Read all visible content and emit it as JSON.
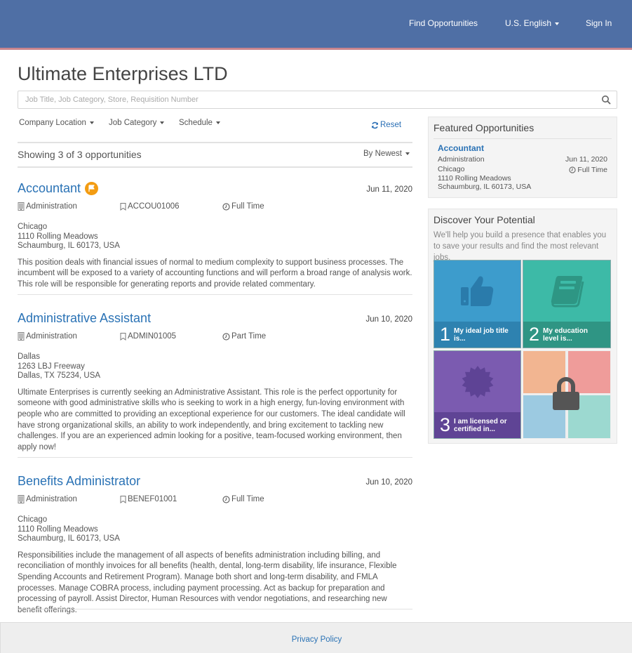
{
  "header": {
    "nav": [
      {
        "label": "Find Opportunities"
      },
      {
        "label": "U.S. English"
      },
      {
        "label": "Sign In"
      }
    ]
  },
  "page": {
    "title": "Ultimate Enterprises LTD",
    "search_placeholder": "Job Title, Job Category, Store, Requisition Number",
    "search_value": ""
  },
  "filters": {
    "items": [
      {
        "label": "Company Location"
      },
      {
        "label": "Job Category"
      },
      {
        "label": "Schedule"
      }
    ],
    "reset_label": "Reset"
  },
  "results": {
    "summary": "Showing 3 of 3 opportunities",
    "sort_label": "By Newest"
  },
  "jobs": [
    {
      "title": "Accountant",
      "featured": true,
      "date": "Jun 11, 2020",
      "category": "Administration",
      "requisition": "ACCOU01006",
      "schedule": "Full Time",
      "address": [
        "Chicago",
        "1110 Rolling Meadows",
        "Schaumburg, IL 60173, USA"
      ],
      "description": "This position deals with financial issues of normal to medium complexity to support business processes. The incumbent will be exposed to a variety of accounting functions and will perform a broad range of analysis work. This role will be responsible for generating reports and provide related commentary."
    },
    {
      "title": "Administrative Assistant",
      "featured": false,
      "date": "Jun 10, 2020",
      "category": "Administration",
      "requisition": "ADMIN01005",
      "schedule": "Part Time",
      "address": [
        "Dallas",
        "1263 LBJ Freeway",
        "Dallas, TX 75234, USA"
      ],
      "description": "Ultimate Enterprises is currently seeking an Administrative Assistant. This role is the perfect opportunity for someone with good administrative skills who is seeking to work in a high energy, fun-loving environment with people who are committed to providing an exceptional experience for our customers. The ideal candidate will have strong organizational skills, an ability to work independently, and bring excitement to tackling new challenges. If you are an experienced admin looking for a positive, team-focused working environment, then apply now!"
    },
    {
      "title": "Benefits Administrator",
      "featured": false,
      "date": "Jun 10, 2020",
      "category": "Administration",
      "requisition": "BENEF01001",
      "schedule": "Full Time",
      "address": [
        "Chicago",
        "1110 Rolling Meadows",
        "Schaumburg, IL 60173, USA"
      ],
      "description": "Responsibilities include the management of all aspects of benefits administration including billing, and reconciliation of monthly invoices for all benefits (health, dental, long-term disability, life insurance, Flexible Spending Accounts and Retirement Program). Manage both short and long-term disability, and FMLA processes. Manage COBRA process, including payment processing. Act as backup for preparation and processing of payroll. Assist Director, Human Resources with vendor negotiations, and researching new benefit offerings."
    }
  ],
  "featured": {
    "title": "Featured Opportunities",
    "item": {
      "title": "Accountant",
      "category": "Administration",
      "date": "Jun 11, 2020",
      "schedule": "Full Time",
      "address": [
        "Chicago",
        "1110 Rolling Meadows",
        "Schaumburg, IL 60173, USA"
      ]
    }
  },
  "discover": {
    "title": "Discover Your Potential",
    "text": "We'll help you build a presence that enables you to save your results and find the most relevant jobs.",
    "tiles": [
      {
        "number": "1",
        "label": "My ideal job title is...",
        "icon": "thumbs-up-icon"
      },
      {
        "number": "2",
        "label": "My education level is...",
        "icon": "book-icon"
      },
      {
        "number": "3",
        "label": "I am licensed or certified in...",
        "icon": "badge-icon"
      }
    ],
    "locked_icon": "lock-icon"
  },
  "footer": {
    "privacy_label": "Privacy Policy"
  },
  "colors": {
    "header": "#4f6fa5",
    "link": "#2a72b5",
    "featured_badge": "#f39c12",
    "tile1": "#3d9ccc",
    "tile2": "#3dbaa7",
    "tile3": "#7b5bb0"
  }
}
